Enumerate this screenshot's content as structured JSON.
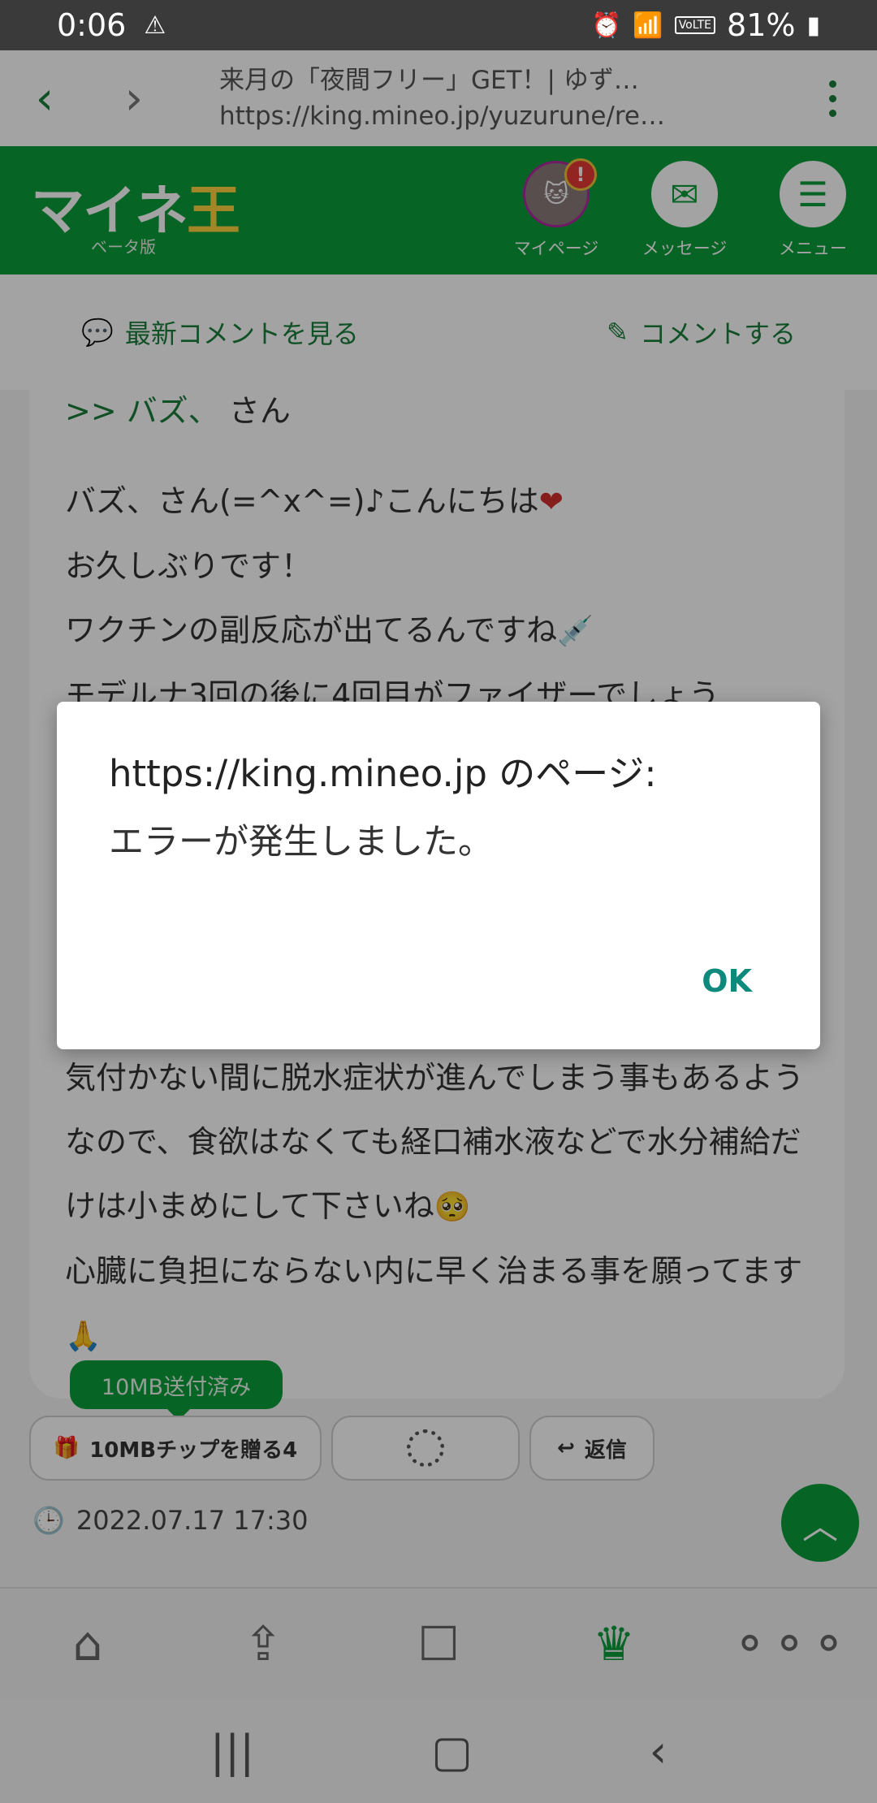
{
  "status_bar": {
    "time": "0:06",
    "alert_icon": "⚠",
    "battery": "81%",
    "volte": "VoLTE"
  },
  "browser": {
    "back_icon": "‹",
    "forward_icon": "›",
    "page_title": "来月の「夜間フリー」GET！| ゆず…",
    "url": "https://king.mineo.jp/yuzurune/re…"
  },
  "site_header": {
    "logo": "マイネ",
    "logo_king": "王",
    "logo_sub": "ベータ版",
    "mypage_label": "マイページ",
    "message_label": "メッセージ",
    "menu_label": "メニュー",
    "alert_badge": "!"
  },
  "actions": {
    "latest_comments": "最新コメントを見る",
    "comment": "コメントする"
  },
  "comment": {
    "reply_prefix": ">> バズ、",
    "reply_suffix": "さん",
    "lines": [
      "バズ、さん(=^x^=)♪こんにちは",
      "お久しぶりです！",
      "ワクチンの副反応が出てるんですね",
      "モデルナ3回の後に4回目がファイザーでしょう"
    ],
    "emoji_heart": "❤",
    "emoji_syringe": "💉",
    "lower_text_1": "気付かない間に脱水症状が進んでしまう事もあるようなので、食欲はなくても経口補水液などで水分補給だけは小まめにして下さいね",
    "emoji_face": "🥺",
    "lower_text_2": "心臓に負担にならない内に早く治まる事を願ってます",
    "emoji_pray": "🙏"
  },
  "tooltip": "10MB送付済み",
  "chips": {
    "gift": "10MBチップを贈る4",
    "reply": "返信"
  },
  "timestamp": "2022.07.17 17:30",
  "dialog": {
    "title": "https://king.mineo.jp のページ:",
    "message": "エラーが発生しました。",
    "ok": "OK"
  }
}
